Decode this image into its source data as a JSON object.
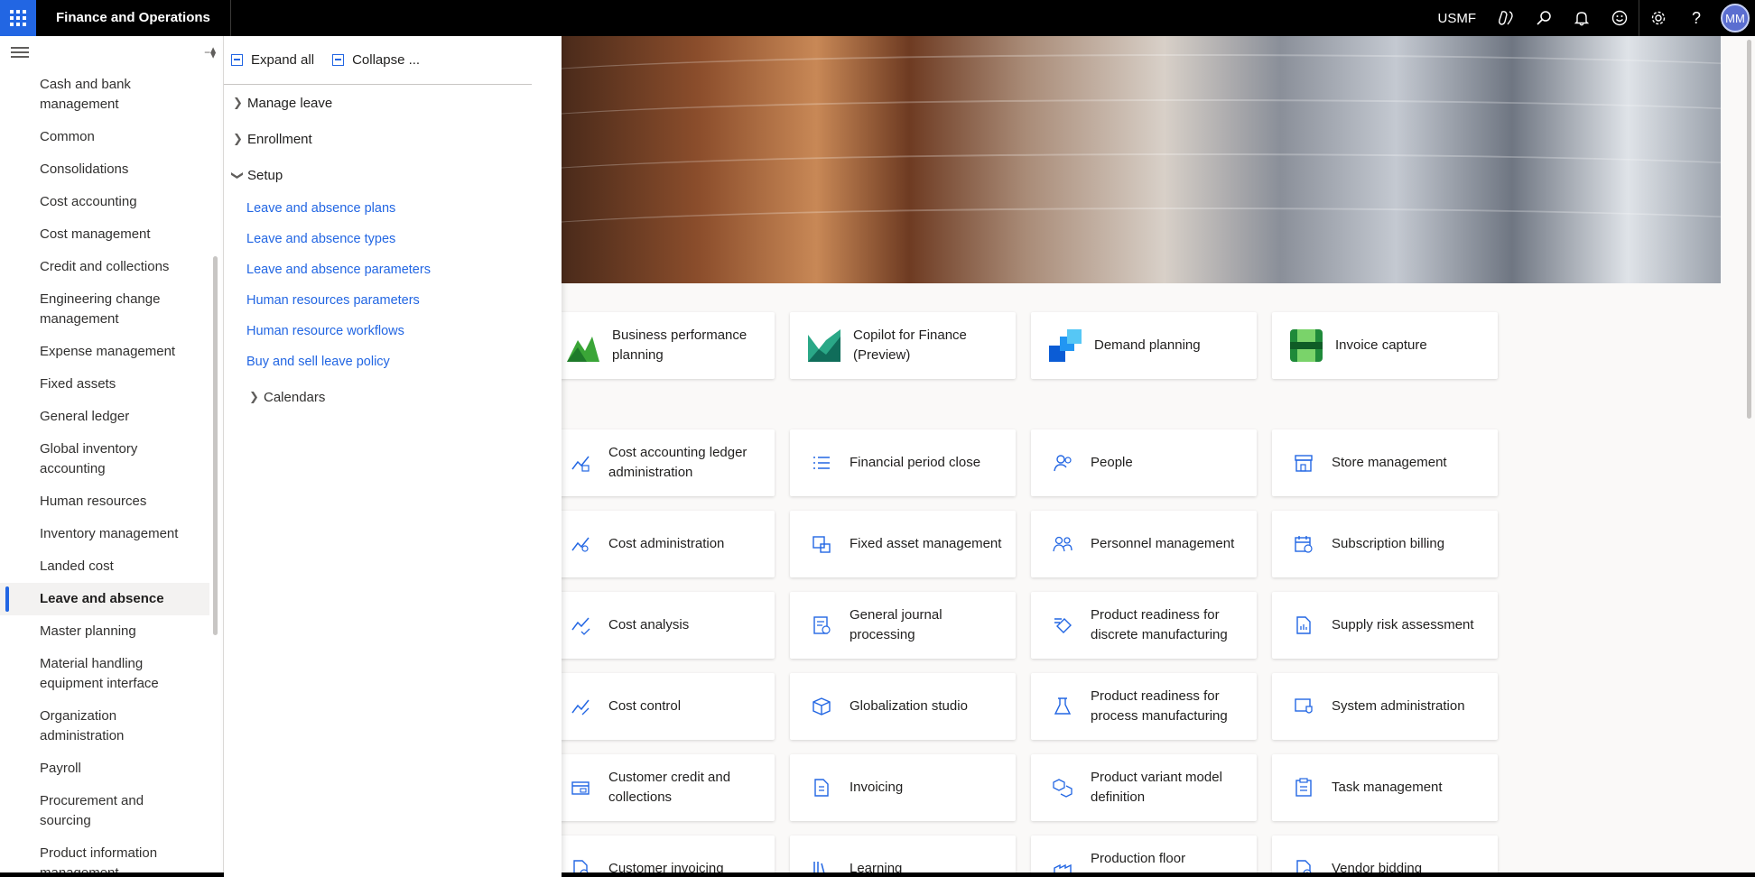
{
  "app": {
    "title": "Finance and Operations",
    "company": "USMF",
    "user_initials": "MM",
    "accent_color": "#2266e3"
  },
  "topbar_icons": [
    "copilot-icon",
    "search-icon",
    "bell-icon",
    "smiley-icon",
    "gear-icon",
    "help-icon"
  ],
  "nav": {
    "items": [
      "Cash and bank management",
      "Common",
      "Consolidations",
      "Cost accounting",
      "Cost management",
      "Credit and collections",
      "Engineering change management",
      "Expense management",
      "Fixed assets",
      "General ledger",
      "Global inventory accounting",
      "Human resources",
      "Inventory management",
      "Landed cost",
      "Leave and absence",
      "Master planning",
      "Material handling equipment interface",
      "Organization administration",
      "Payroll",
      "Procurement and sourcing",
      "Product information management"
    ],
    "active": "Leave and absence"
  },
  "flyout": {
    "expand_all": "Expand all",
    "collapse": "Collapse ...",
    "groups": {
      "manage_leave": "Manage leave",
      "enrollment": "Enrollment",
      "setup": "Setup"
    },
    "setup_links": [
      "Leave and absence plans",
      "Leave and absence types",
      "Leave and absence parameters",
      "Human resources parameters",
      "Human resource workflows",
      "Buy and sell leave policy"
    ],
    "calendars": "Calendars"
  },
  "tiles": {
    "featured": [
      "Business performance planning",
      "Copilot for Finance (Preview)",
      "Demand planning",
      "Invoice capture"
    ],
    "workspaces": [
      "Cost accounting ledger administration",
      "Financial period close",
      "People",
      "Store management",
      "Cost administration",
      "Fixed asset management",
      "Personnel management",
      "Subscription billing",
      "Cost analysis",
      "General journal processing",
      "Product readiness for discrete manufacturing",
      "Supply risk assessment",
      "Cost control",
      "Globalization studio",
      "Product readiness for process manufacturing",
      "System administration",
      "Customer credit and collections",
      "Invoicing",
      "Product variant model definition",
      "Task management",
      "Customer invoicing",
      "Learning",
      "Production floor management",
      "Vendor bidding"
    ]
  }
}
